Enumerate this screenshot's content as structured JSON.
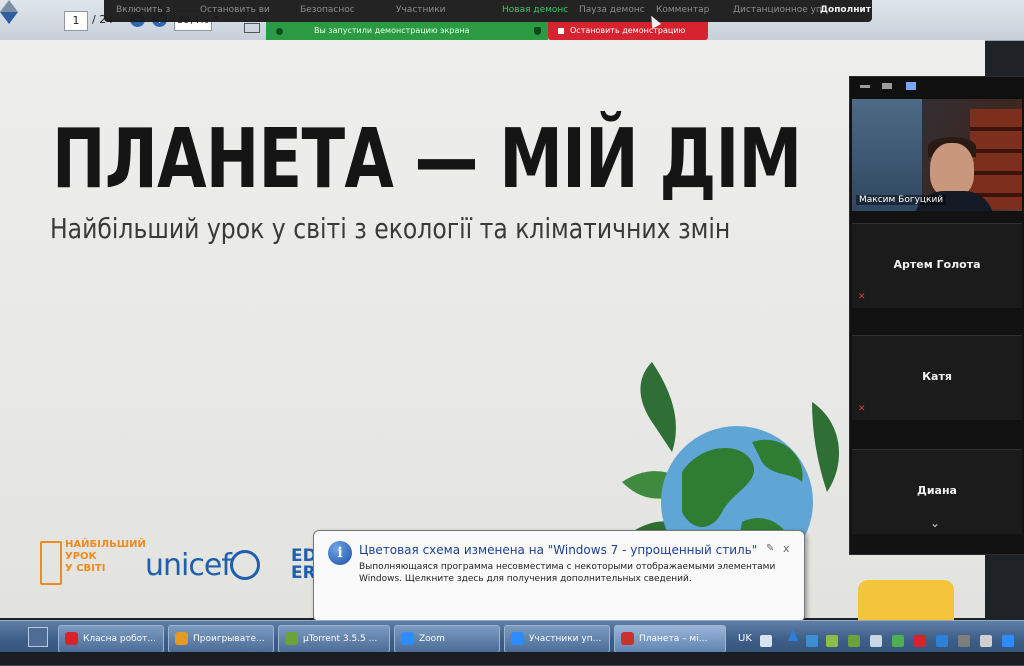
{
  "pdf_toolbar": {
    "page_current": "1",
    "page_total": "/ 24",
    "zoom_level": "39,4%"
  },
  "zoom_controls": {
    "menu_items": [
      "Включить з",
      "Остановить ви",
      "Безопаснос",
      "Участники",
      "Новая демонс",
      "Пауза демонс",
      "Комментар",
      "Дистанционное уп",
      "Дополнит"
    ],
    "share_banner": "Вы запустили демонстрацию экрана",
    "stop_share": "Остановить демонстрацию"
  },
  "slide": {
    "title": "ПЛАНЕТА — МІЙ ДІМ",
    "subtitle": "Найбільший урок у світі з екології та кліматичних змін",
    "logo_lesson": "НАЙБІЛЬШИЙ\nУРОК\nУ СВІТІ",
    "logo_unicef": "unicef",
    "logo_ed": "ED\nER"
  },
  "zoom_panel": {
    "video_participant": "Максим Богуцкий",
    "participants": [
      "Артем Голота",
      "Катя",
      "Диана"
    ],
    "more_indicator": "⌄"
  },
  "notification": {
    "title": "Цветовая схема изменена на \"Windows 7 - упрощенный стиль\"",
    "body": "Выполняющаяся программа несовместима с некоторыми отображаемыми элементами Windows.  Щелкните здесь для получения дополнительных сведений.",
    "close": "x"
  },
  "taskbar": {
    "items": [
      {
        "label": "Класна робот...",
        "icon_color": "#d8232a"
      },
      {
        "label": "Проигрывате...",
        "icon_color": "#e39a20"
      },
      {
        "label": "µTorrent 3.5.5 ...",
        "icon_color": "#6aa33a"
      },
      {
        "label": "Zoom",
        "icon_color": "#2d8cff"
      },
      {
        "label": "Участники уп...",
        "icon_color": "#2d8cff"
      },
      {
        "label": "Планета – мі...",
        "icon_color": "#c8332e"
      }
    ],
    "language": "UK"
  },
  "colors": {
    "zoom_green": "#2b9a43",
    "zoom_red": "#d5242f",
    "unicef_blue": "#1f5fae",
    "lesson_orange": "#f08a1d"
  }
}
